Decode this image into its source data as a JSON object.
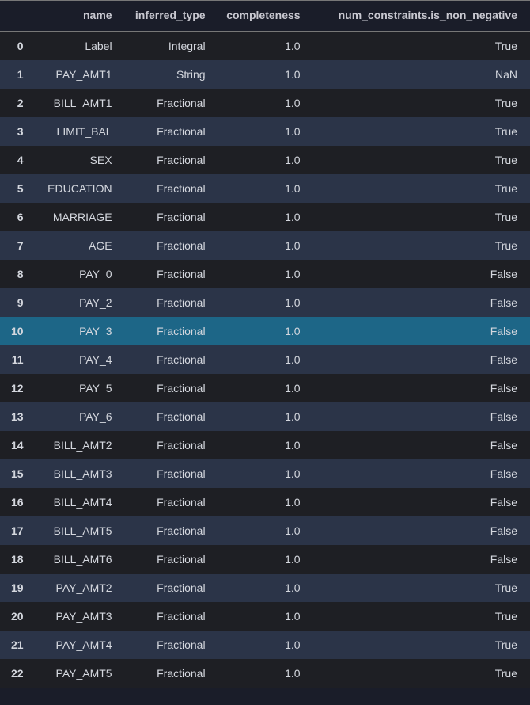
{
  "columns": {
    "index": "",
    "name": "name",
    "inferred_type": "inferred_type",
    "completeness": "completeness",
    "constraint": "num_constraints.is_non_negative"
  },
  "highlighted_index": 10,
  "rows": [
    {
      "idx": "0",
      "name": "Label",
      "inferred_type": "Integral",
      "completeness": "1.0",
      "constraint": "True"
    },
    {
      "idx": "1",
      "name": "PAY_AMT1",
      "inferred_type": "String",
      "completeness": "1.0",
      "constraint": "NaN"
    },
    {
      "idx": "2",
      "name": "BILL_AMT1",
      "inferred_type": "Fractional",
      "completeness": "1.0",
      "constraint": "True"
    },
    {
      "idx": "3",
      "name": "LIMIT_BAL",
      "inferred_type": "Fractional",
      "completeness": "1.0",
      "constraint": "True"
    },
    {
      "idx": "4",
      "name": "SEX",
      "inferred_type": "Fractional",
      "completeness": "1.0",
      "constraint": "True"
    },
    {
      "idx": "5",
      "name": "EDUCATION",
      "inferred_type": "Fractional",
      "completeness": "1.0",
      "constraint": "True"
    },
    {
      "idx": "6",
      "name": "MARRIAGE",
      "inferred_type": "Fractional",
      "completeness": "1.0",
      "constraint": "True"
    },
    {
      "idx": "7",
      "name": "AGE",
      "inferred_type": "Fractional",
      "completeness": "1.0",
      "constraint": "True"
    },
    {
      "idx": "8",
      "name": "PAY_0",
      "inferred_type": "Fractional",
      "completeness": "1.0",
      "constraint": "False"
    },
    {
      "idx": "9",
      "name": "PAY_2",
      "inferred_type": "Fractional",
      "completeness": "1.0",
      "constraint": "False"
    },
    {
      "idx": "10",
      "name": "PAY_3",
      "inferred_type": "Fractional",
      "completeness": "1.0",
      "constraint": "False"
    },
    {
      "idx": "11",
      "name": "PAY_4",
      "inferred_type": "Fractional",
      "completeness": "1.0",
      "constraint": "False"
    },
    {
      "idx": "12",
      "name": "PAY_5",
      "inferred_type": "Fractional",
      "completeness": "1.0",
      "constraint": "False"
    },
    {
      "idx": "13",
      "name": "PAY_6",
      "inferred_type": "Fractional",
      "completeness": "1.0",
      "constraint": "False"
    },
    {
      "idx": "14",
      "name": "BILL_AMT2",
      "inferred_type": "Fractional",
      "completeness": "1.0",
      "constraint": "False"
    },
    {
      "idx": "15",
      "name": "BILL_AMT3",
      "inferred_type": "Fractional",
      "completeness": "1.0",
      "constraint": "False"
    },
    {
      "idx": "16",
      "name": "BILL_AMT4",
      "inferred_type": "Fractional",
      "completeness": "1.0",
      "constraint": "False"
    },
    {
      "idx": "17",
      "name": "BILL_AMT5",
      "inferred_type": "Fractional",
      "completeness": "1.0",
      "constraint": "False"
    },
    {
      "idx": "18",
      "name": "BILL_AMT6",
      "inferred_type": "Fractional",
      "completeness": "1.0",
      "constraint": "False"
    },
    {
      "idx": "19",
      "name": "PAY_AMT2",
      "inferred_type": "Fractional",
      "completeness": "1.0",
      "constraint": "True"
    },
    {
      "idx": "20",
      "name": "PAY_AMT3",
      "inferred_type": "Fractional",
      "completeness": "1.0",
      "constraint": "True"
    },
    {
      "idx": "21",
      "name": "PAY_AMT4",
      "inferred_type": "Fractional",
      "completeness": "1.0",
      "constraint": "True"
    },
    {
      "idx": "22",
      "name": "PAY_AMT5",
      "inferred_type": "Fractional",
      "completeness": "1.0",
      "constraint": "True"
    }
  ]
}
